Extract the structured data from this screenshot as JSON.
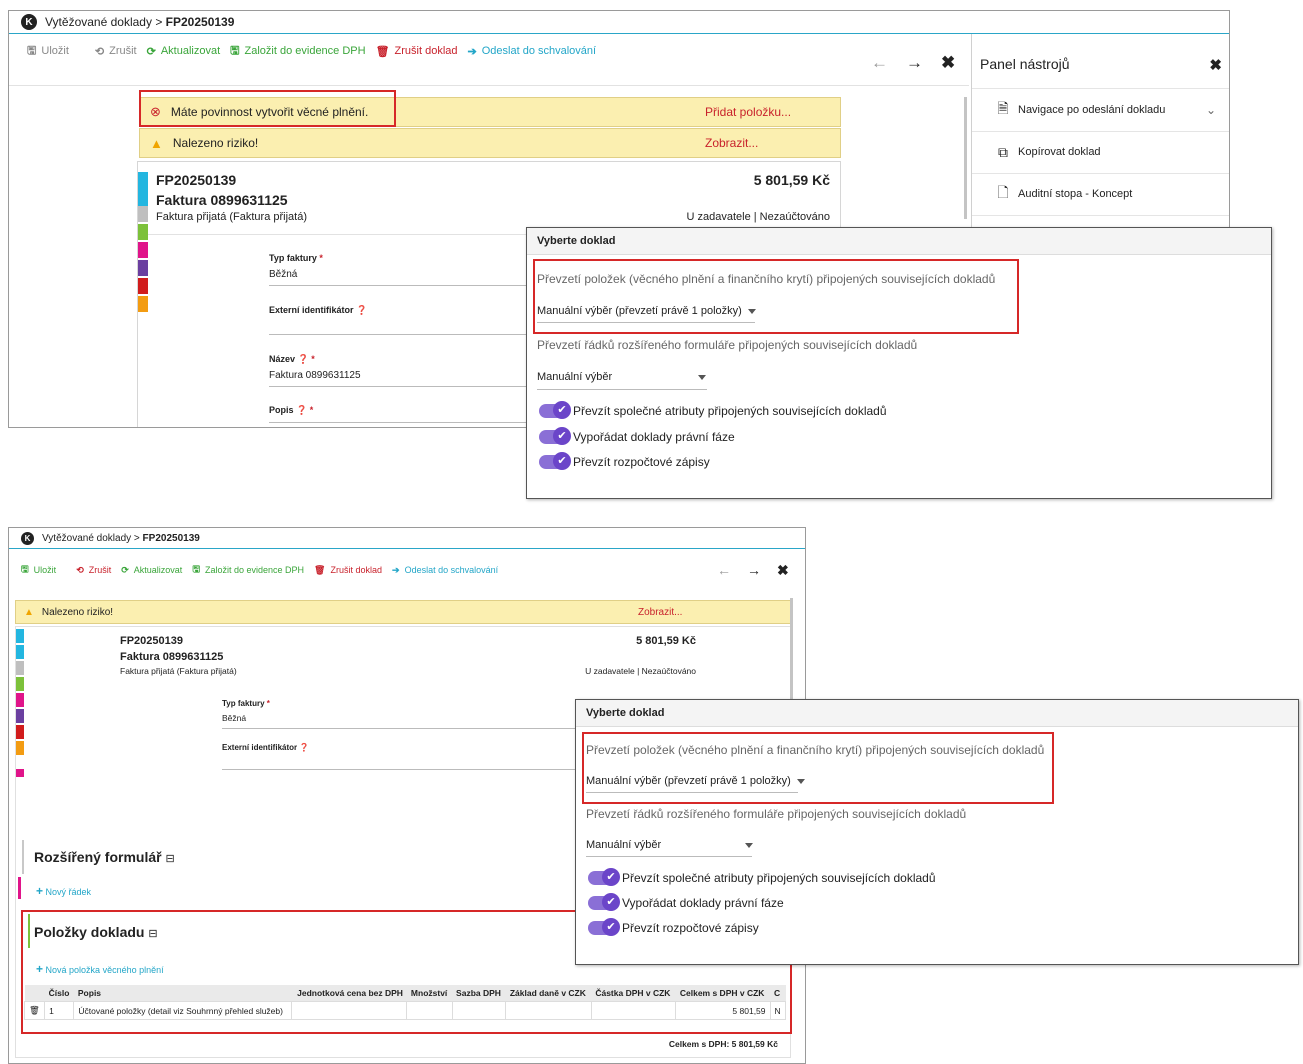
{
  "top": {
    "breadcrumb_parent": "Vytěžované doklady",
    "breadcrumb_sep": ">",
    "breadcrumb_doc": "FP20250139",
    "toolbar": {
      "save": "Uložit",
      "cancel": "Zrušit",
      "refresh": "Aktualizovat",
      "vat": "Založit do evidence DPH",
      "cancel_doc": "Zrušit doklad",
      "approve": "Odeslat do schvalování"
    },
    "alert1": "Máte povinnost vytvořit věcné plnění.",
    "alert1_link": "Přidat položku...",
    "alert2": "Nalezeno riziko!",
    "alert2_link": "Zobrazit...",
    "doc_number": "FP20250139",
    "amount": "5 801,59 Kč",
    "invoice_title": "Faktura 0899631125",
    "invoice_type": "Faktura přijatá (Faktura přijatá)",
    "status": "U zadavatele | Nezaúčtováno",
    "f_type_label": "Typ faktury",
    "f_type_value": "Běžná",
    "f_ext_label": "Externí identifikátor",
    "f_name_label": "Název",
    "f_name_value": "Faktura 0899631125",
    "f_desc_label": "Popis",
    "panel": {
      "title": "Panel nástrojů",
      "items": [
        "Navigace po odeslání dokladu",
        "Kopírovat doklad",
        "Auditní stopa - Koncept"
      ]
    }
  },
  "dialog": {
    "title": "Vyberte doklad",
    "line1": "Převzetí položek (věcného plnění a finančního krytí) připojených souvisejících dokladů",
    "select1": "Manuální výběr (převzetí právě 1 položky)",
    "line2": "Převzetí řádků rozšířeného formuláře připojených souvisejících dokladů",
    "select2": "Manuální výběr",
    "toggle1": "Převzít společné atributy připojených souvisejících dokladů",
    "toggle2": "Vypořádat doklady právní fáze",
    "toggle3": "Převzít rozpočtové zápisy"
  },
  "bottom": {
    "ext_form": "Rozšířený formulář",
    "new_row": "Nový řádek",
    "items_title": "Položky dokladu",
    "new_item": "Nová položka věcného plnění",
    "columns": [
      "Číslo",
      "Popis",
      "Jednotková cena bez DPH",
      "Množství",
      "Sazba DPH",
      "Základ daně v CZK",
      "Částka DPH v CZK",
      "Celkem s DPH v CZK",
      "C"
    ],
    "row": [
      "1",
      "Účtované položky (detail viz Souhrnný přehled služeb)",
      "",
      "",
      "",
      "",
      "",
      "5 801,59",
      "N"
    ],
    "total": "Celkem s DPH: 5 801,59 Kč"
  },
  "colors": {
    "accent": "#23a6c8",
    "danger": "#c8222c",
    "success": "#3aa53a",
    "toggle": "#6b45c9",
    "banner": "#fbefb0"
  }
}
